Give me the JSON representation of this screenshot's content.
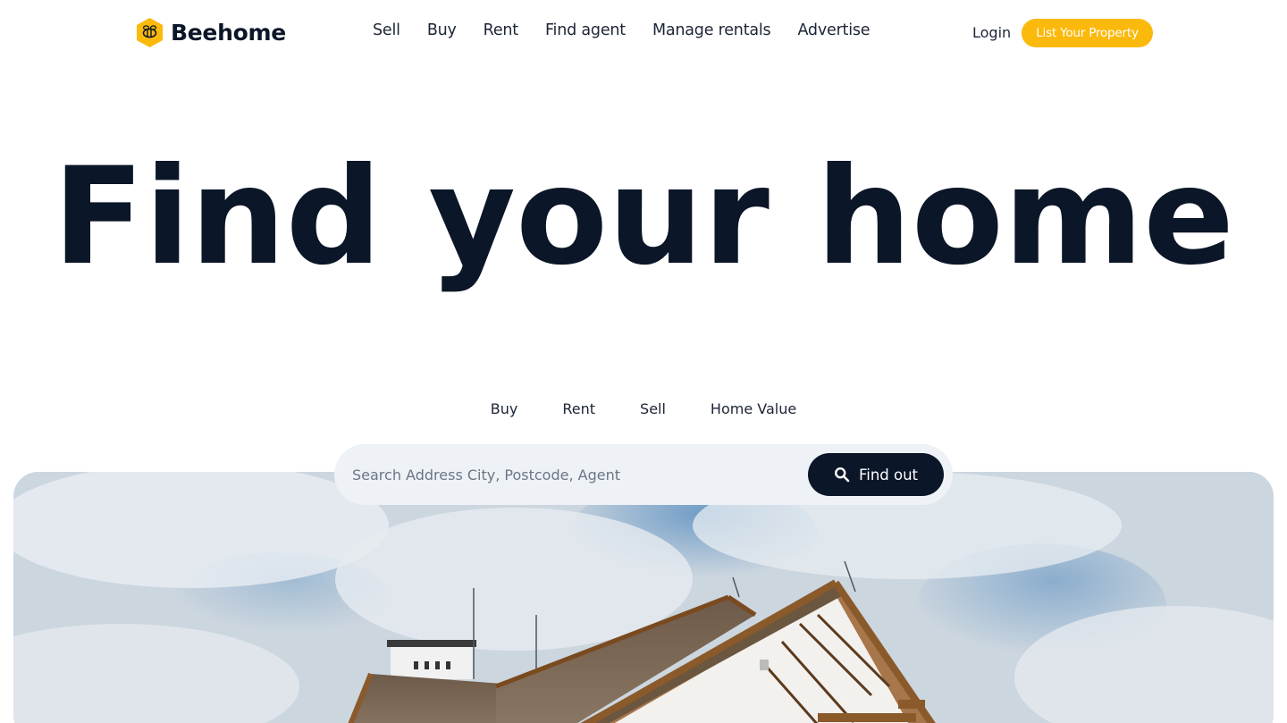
{
  "brand": {
    "name": "Beehome",
    "logo_icon": "bee-icon",
    "accent": "#fbb90b"
  },
  "nav": {
    "items": [
      {
        "label": "Sell"
      },
      {
        "label": "Buy"
      },
      {
        "label": "Rent"
      },
      {
        "label": "Find agent"
      },
      {
        "label": "Manage rentals"
      },
      {
        "label": "Advertise"
      }
    ],
    "login_label": "Login",
    "cta_label": "List Your Property"
  },
  "hero": {
    "title": "Find your home"
  },
  "tabs": [
    {
      "label": "Buy"
    },
    {
      "label": "Rent"
    },
    {
      "label": "Sell"
    },
    {
      "label": "Home Value"
    }
  ],
  "search": {
    "placeholder": "Search Address City, Postcode, Agent",
    "value": "",
    "button_label": "Find out",
    "button_icon": "search-icon"
  },
  "colors": {
    "primary_dark": "#0b1628",
    "accent": "#fbb90b",
    "search_bg": "#eef2f7"
  }
}
